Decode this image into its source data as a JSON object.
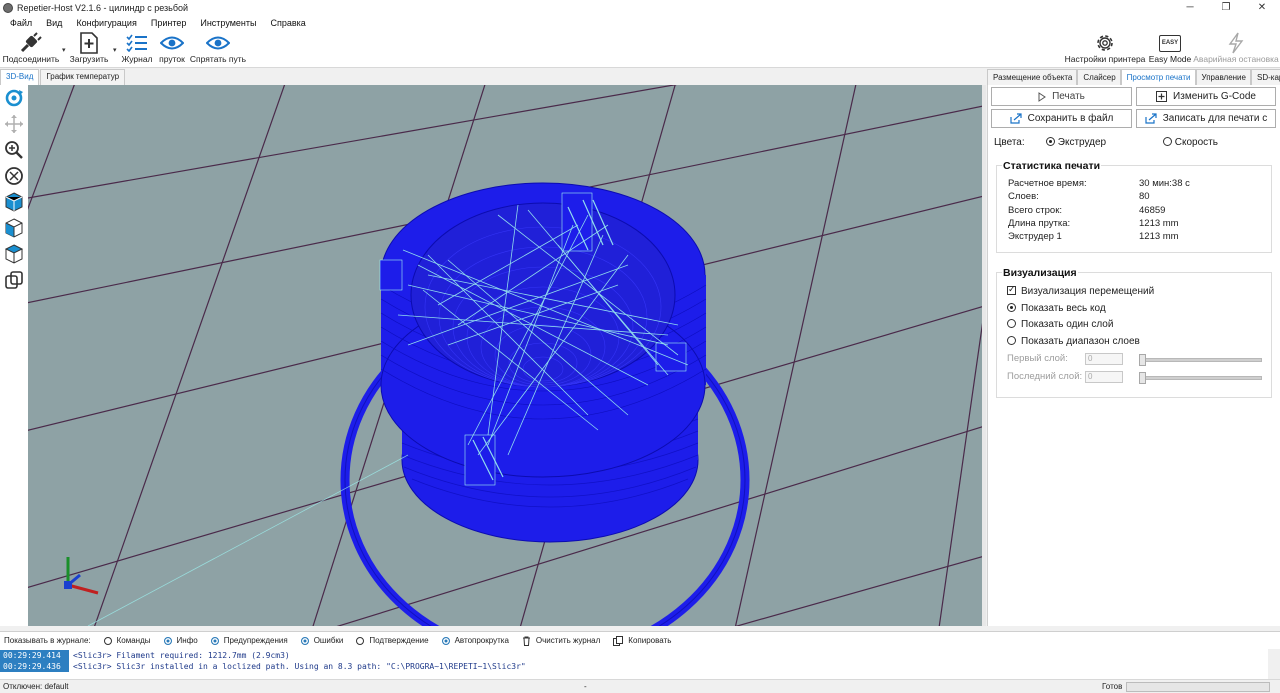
{
  "window": {
    "title": "Repetier-Host V2.1.6 - цилиндр с резьбой",
    "controls": [
      "─",
      "❐",
      "✕"
    ]
  },
  "menu": [
    "Файл",
    "Вид",
    "Конфигурация",
    "Принтер",
    "Инструменты",
    "Справка"
  ],
  "toolbar": {
    "connect": "Подсоединить",
    "load": "Загрузить",
    "journal": "Журнал",
    "filament": "пруток",
    "hide_path": "Спрятать путь",
    "printer_settings": "Настройки принтера",
    "easy_mode": "Easy Mode",
    "easy_badge": "EASY",
    "emergency_stop": "Аварийная остановка"
  },
  "view_tabs": [
    "3D-Вид",
    "График температур"
  ],
  "right_tabs": [
    "Размещение объекта",
    "Слайсер",
    "Просмотр печати",
    "Управление",
    "SD-карта"
  ],
  "preview": {
    "print_button": "Печать",
    "edit_gcode_button": "Изменить G-Code",
    "save_file_button": "Сохранить в файл",
    "write_sd_button": "Записать для печати с",
    "colors_label": "Цвета:",
    "color_extruder": "Экструдер",
    "color_speed": "Скорость",
    "stats_title": "Статистика печати",
    "stats": [
      {
        "label": "Расчетное время:",
        "value": "30 мин:38 с"
      },
      {
        "label": "Слоев:",
        "value": "80"
      },
      {
        "label": "Всего строк:",
        "value": "46859"
      },
      {
        "label": "Длина прутка:",
        "value": "1213 mm"
      },
      {
        "label": "Экструдер 1",
        "value": "1213 mm"
      }
    ],
    "vis_title": "Визуализация",
    "show_travel": "Визуализация перемещений",
    "show_all": "Показать весь код",
    "show_one_layer": "Показать один слой",
    "show_layer_range": "Показать диапазон слоев",
    "first_layer": "Первый слой:",
    "last_layer": "Последний слой:",
    "first_layer_value": "0",
    "last_layer_value": "0"
  },
  "logbar": {
    "show_label": "Показывать в журнале:",
    "commands": "Команды",
    "info": "Инфо",
    "warnings": "Предупреждения",
    "errors": "Ошибки",
    "acks": "Подтверждение",
    "autoscroll": "Автопрокрутка",
    "clear": "Очистить журнал",
    "copy": "Копировать"
  },
  "log": [
    {
      "time": "00:29:29.414",
      "text": "<Slic3r> Filament required: 1212.7mm (2.9cm3)"
    },
    {
      "time": "00:29:29.436",
      "text": "<Slic3r> Slic3r installed in a loclized path. Using an 8.3 path: \"C:\\PROGRA~1\\REPETI~1\\Slic3r\""
    }
  ],
  "status": {
    "connection": "Отключен: default",
    "middle": "-",
    "ready": "Готов"
  },
  "colors": {
    "accent": "#1a73c8",
    "model_blue": "#1d1dea",
    "travel_cyan": "#9ef2f0",
    "viewport_bg": "#8ea2a5",
    "grid_line": "#4a2a4a"
  }
}
